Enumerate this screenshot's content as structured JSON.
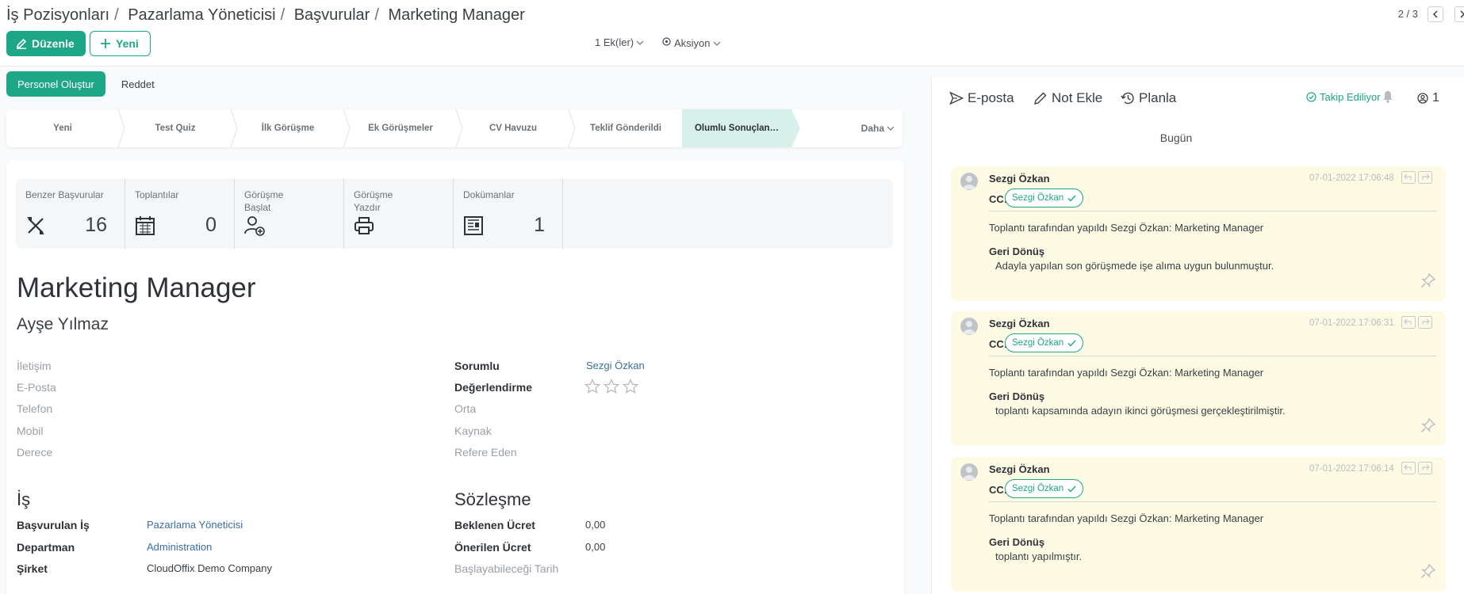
{
  "breadcrumb": [
    "İş Pozisyonları",
    "Pazarlama Yöneticisi",
    "Başvurular",
    "Marketing Manager"
  ],
  "toolbar": {
    "edit_label": "Düzenle",
    "new_label": "Yeni",
    "attachments_label": "1 Ek(ler)",
    "action_label": "Aksiyon"
  },
  "pager": {
    "value": "2 / 3"
  },
  "status_actions": {
    "create_employee": "Personel Oluştur",
    "refuse": "Reddet"
  },
  "stages": [
    "Yeni",
    "Test Quiz",
    "İlk Görüşme",
    "Ek Görüşmeler",
    "CV Havuzu",
    "Teklif Gönderildi",
    "Olumlu Sonuçlan…"
  ],
  "active_stage": 6,
  "stage_more": "Daha",
  "smart_buttons": [
    {
      "label": "Benzer Başvurular",
      "value": "16",
      "icon": "tools-icon"
    },
    {
      "label": "Toplantılar",
      "value": "0",
      "icon": "calendar-icon"
    },
    {
      "label": "Görüşme Başlat",
      "value": "",
      "icon": "user-plus-icon"
    },
    {
      "label": "Görüşme Yazdır",
      "value": "",
      "icon": "print-icon"
    },
    {
      "label": "Dokümanlar",
      "value": "1",
      "icon": "document-icon"
    }
  ],
  "record": {
    "title": "Marketing Manager",
    "applicant": "Ayşe Yılmaz"
  },
  "left_fields": [
    "İletişim",
    "E-Posta",
    "Telefon",
    "Mobil",
    "Derece"
  ],
  "right_fields": {
    "responsible_label": "Sorumlu",
    "responsible_value": "Sezgi Özkan",
    "rating_label": "Değerlendirme",
    "rating": 0,
    "medium": "Orta",
    "source": "Kaynak",
    "referrer": "Refere Eden"
  },
  "job_section": {
    "title": "İş",
    "applied_job_label": "Başvurulan İş",
    "applied_job_value": "Pazarlama Yöneticisi",
    "department_label": "Departman",
    "department_value": "Administration",
    "company_label": "Şirket",
    "company_value": "CloudOffix Demo Company"
  },
  "contract_section": {
    "title": "Sözleşme",
    "expected_label": "Beklenen Ücret",
    "expected_value": "0,00",
    "proposed_label": "Önerilen Ücret",
    "proposed_value": "0,00",
    "availability_label": "Başlayabileceği Tarih"
  },
  "chatter": {
    "email": "E-posta",
    "note": "Not Ekle",
    "schedule": "Planla",
    "following": "Takip Ediliyor",
    "followers_count": "1",
    "today": "Bugün",
    "messages": [
      {
        "author": "Sezgi Özkan",
        "date": "07-01-2022 17:06:48",
        "cc_label": "CC:",
        "cc": "Sezgi Özkan",
        "text": "Toplantı tarafından yapıldı Sezgi Özkan: Marketing Manager",
        "feedback_label": "Geri Dönüş",
        "feedback": "Adayla yapılan son görüşmede işe alıma uygun bulunmuştur."
      },
      {
        "author": "Sezgi Özkan",
        "date": "07-01-2022 17:06:31",
        "cc_label": "CC:",
        "cc": "Sezgi Özkan",
        "text": "Toplantı tarafından yapıldı Sezgi Özkan: Marketing Manager",
        "feedback_label": "Geri Dönüş",
        "feedback": "toplantı kapsamında adayın ikinci görüşmesi gerçekleştirilmiştir."
      },
      {
        "author": "Sezgi Özkan",
        "date": "07-01-2022 17:06:14",
        "cc_label": "CC:",
        "cc": "Sezgi Özkan",
        "text": "Toplantı tarafından yapıldı Sezgi Özkan: Marketing Manager",
        "feedback_label": "Geri Dönüş",
        "feedback": "toplantı yapılmıştır."
      }
    ]
  },
  "colors": {
    "accent": "#1ea786",
    "link": "#3a6ea5",
    "message_bg": "#fdfbe4"
  }
}
